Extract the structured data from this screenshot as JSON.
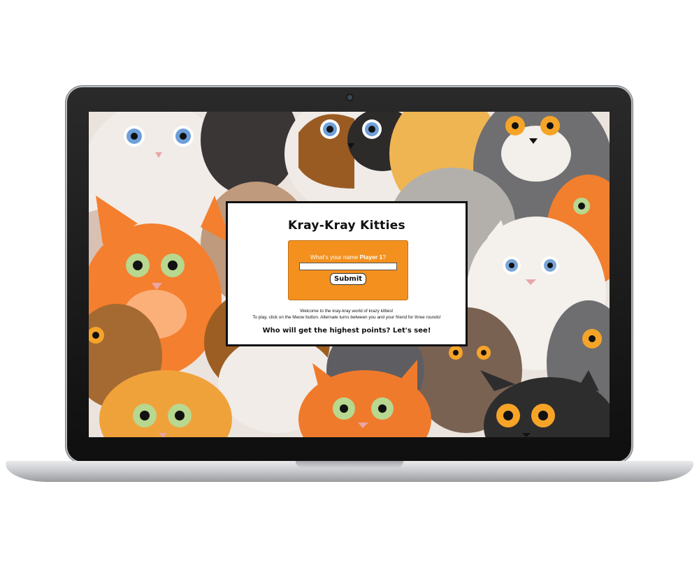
{
  "app": {
    "title": "Kray-Kray Kitties"
  },
  "form": {
    "prompt_prefix": "What's your name",
    "player_label": "Player 1",
    "prompt_suffix": "?",
    "name_value": "",
    "submit_label": "Submit"
  },
  "instructions": {
    "line1": "Welcome to the kray-kray world of krazy kitties!",
    "line2": "To play, click on the Meow button. Alternate turns between you and your friend for three rounds!"
  },
  "tagline": "Who will get the highest points? Let's see!",
  "colors": {
    "dialog_border": "#111111",
    "form_background": "#f4911e",
    "screen_background": "#ebe4de"
  },
  "icons": {
    "camera": "webcam-dot",
    "background": "cartoon-cat-pattern"
  }
}
